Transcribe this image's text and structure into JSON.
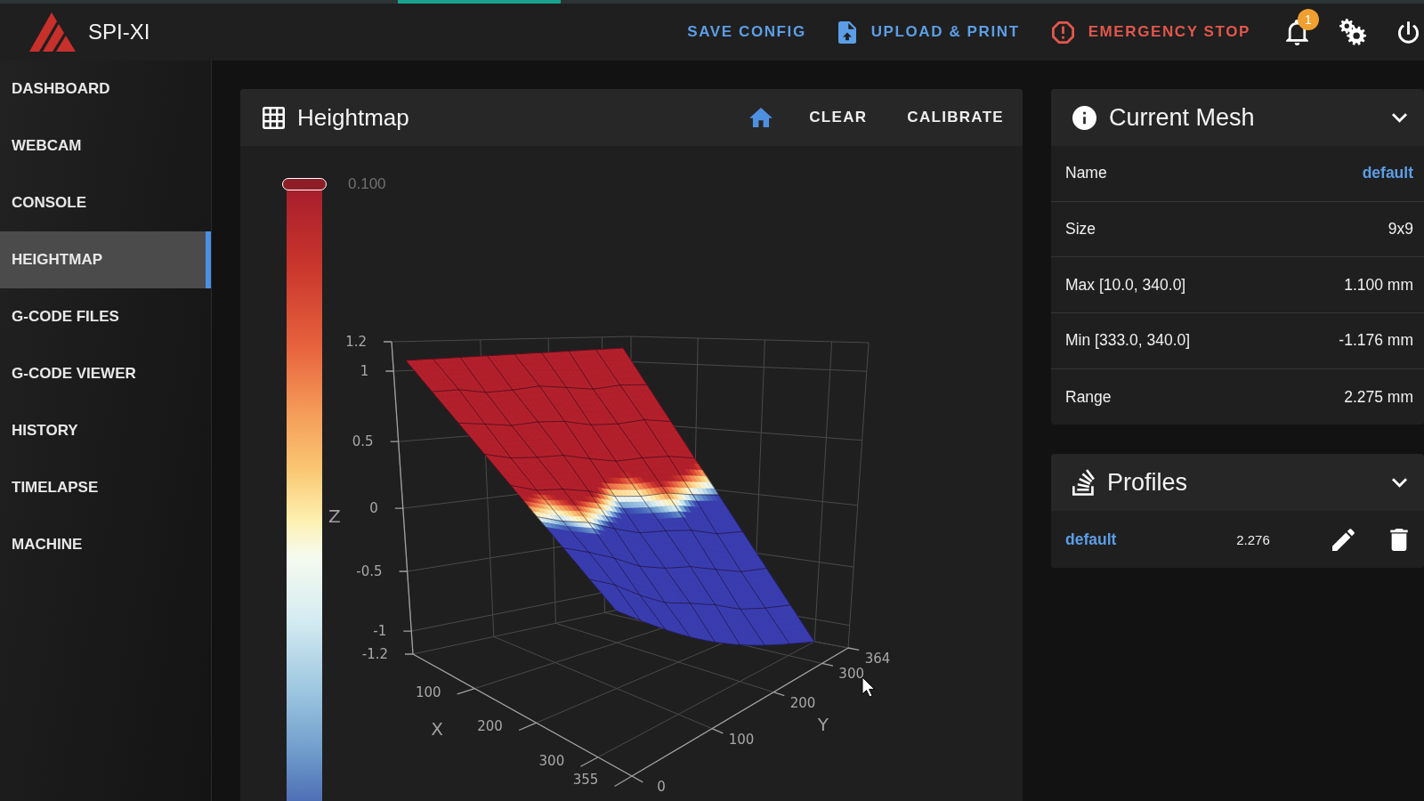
{
  "app": {
    "title": "SPI-XI"
  },
  "toolbar": {
    "actions": [
      {
        "label": "SAVE CONFIG",
        "kind": "save"
      },
      {
        "label": "UPLOAD & PRINT",
        "kind": "upload"
      },
      {
        "label": "EMERGENCY STOP",
        "kind": "stop"
      }
    ],
    "notification_count": "1"
  },
  "sidebar": {
    "items": [
      {
        "label": "DASHBOARD",
        "selected": false
      },
      {
        "label": "WEBCAM",
        "selected": false
      },
      {
        "label": "CONSOLE",
        "selected": false
      },
      {
        "label": "HEIGHTMAP",
        "selected": true
      },
      {
        "label": "G-CODE FILES",
        "selected": false
      },
      {
        "label": "G-CODE VIEWER",
        "selected": false
      },
      {
        "label": "HISTORY",
        "selected": false
      },
      {
        "label": "TIMELAPSE",
        "selected": false
      },
      {
        "label": "MACHINE",
        "selected": false
      }
    ]
  },
  "heightmap": {
    "title": "Heightmap",
    "actions": [
      "CLEAR",
      "CALIBRATE"
    ],
    "colorbar": {
      "label": "0.100",
      "level": 1
    },
    "plot": {
      "z_title": "Z",
      "x_title": "X",
      "y_title": "Y",
      "z_ticks": [
        "1.2",
        "1",
        "0.5",
        "0",
        "-0.5",
        "-1",
        "-1.2"
      ],
      "x_ticks": [
        "100",
        "200",
        "300",
        "355"
      ],
      "y_ticks": [
        "0",
        "100",
        "200",
        "300",
        "364"
      ]
    }
  },
  "current_mesh": {
    "title": "Current Mesh",
    "rows": [
      {
        "label": "Name",
        "value": "default",
        "kind": "link"
      },
      {
        "label": "Size",
        "value": "9x9",
        "kind": "text"
      },
      {
        "label": "Max [10.0, 340.0]",
        "value": "1.100 mm",
        "kind": "text"
      },
      {
        "label": "Min [333.0, 340.0]",
        "value": "-1.176 mm",
        "kind": "text"
      },
      {
        "label": "Range",
        "value": "2.275 mm",
        "kind": "text"
      }
    ]
  },
  "profiles": {
    "title": "Profiles",
    "items": [
      {
        "name": "default",
        "range": "2.276"
      }
    ]
  }
}
